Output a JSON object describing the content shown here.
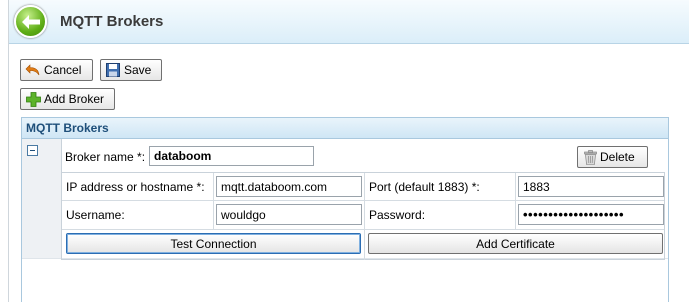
{
  "header": {
    "title": "MQTT Brokers"
  },
  "toolbar": {
    "cancel_label": "Cancel",
    "save_label": "Save",
    "add_broker_label": "Add Broker"
  },
  "panel": {
    "title": "MQTT Brokers"
  },
  "broker": {
    "name_label": "Broker name *:",
    "name_value": "databoom",
    "delete_label": "Delete",
    "host_label": "IP address or hostname *:",
    "host_value": "mqtt.databoom.com",
    "port_label": "Port (default 1883) *:",
    "port_value": "1883",
    "username_label": "Username:",
    "username_value": "wouldgo",
    "password_label": "Password:",
    "password_value": "••••••••••••••••••••",
    "test_connection_label": "Test Connection",
    "add_certificate_label": "Add Certificate"
  },
  "colors": {
    "accent": "#1e4f7a",
    "header_bg": "#dbeef9",
    "back_button": "#5fae16"
  },
  "icons": [
    "back-arrow-icon",
    "undo-icon",
    "floppy-disk-icon",
    "plus-icon",
    "trash-icon",
    "collapse-icon"
  ]
}
